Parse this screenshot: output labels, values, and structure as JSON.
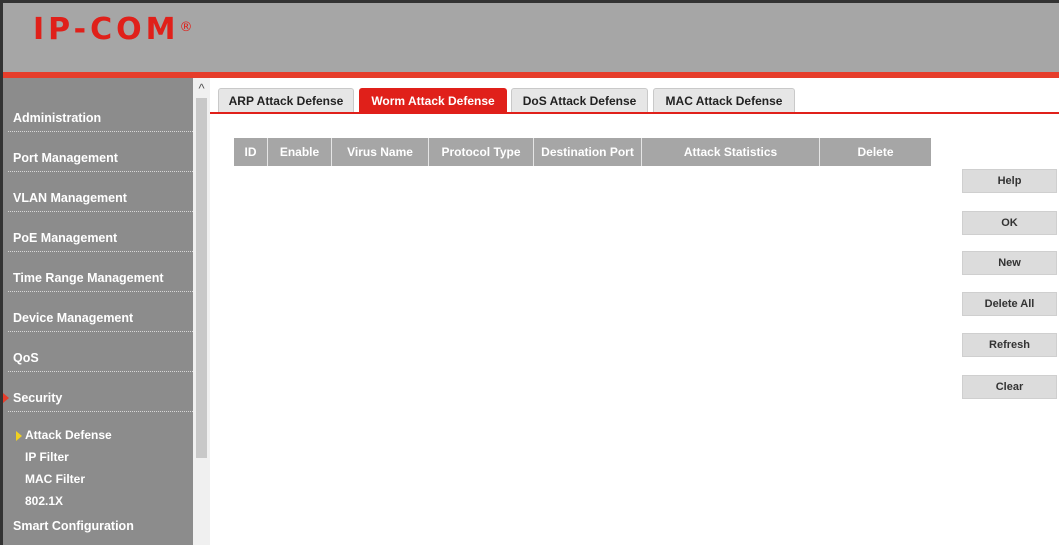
{
  "brand": {
    "logo_text": "IP-COM",
    "logo_mark": "®"
  },
  "colors": {
    "accent": "#e0201a",
    "sidebar_bg": "#8c8c8c",
    "header_bg": "#a6a6a6",
    "table_header_bg": "#a6a6a6"
  },
  "sidebar": {
    "items": [
      {
        "label": "Administration"
      },
      {
        "label": "Port Management"
      },
      {
        "label": "VLAN Management"
      },
      {
        "label": "PoE Management"
      },
      {
        "label": "Time Range Management"
      },
      {
        "label": "Device Management"
      },
      {
        "label": "QoS"
      },
      {
        "label": "Security",
        "active": true
      }
    ],
    "sub_items": [
      {
        "label": "Attack Defense",
        "active": true
      },
      {
        "label": "IP Filter"
      },
      {
        "label": "MAC Filter"
      },
      {
        "label": "802.1X"
      }
    ],
    "last_item": {
      "label": "Smart Configuration"
    }
  },
  "tabs": [
    {
      "label": "ARP Attack Defense"
    },
    {
      "label": "Worm Attack Defense",
      "active": true
    },
    {
      "label": "DoS Attack Defense"
    },
    {
      "label": "MAC Attack Defense"
    }
  ],
  "table": {
    "columns": [
      "ID",
      "Enable",
      "Virus Name",
      "Protocol Type",
      "Destination Port",
      "Attack Statistics",
      "Delete"
    ],
    "rows": []
  },
  "actions": {
    "help": "Help",
    "ok": "OK",
    "new": "New",
    "delete_all": "Delete All",
    "refresh": "Refresh",
    "clear": "Clear"
  }
}
